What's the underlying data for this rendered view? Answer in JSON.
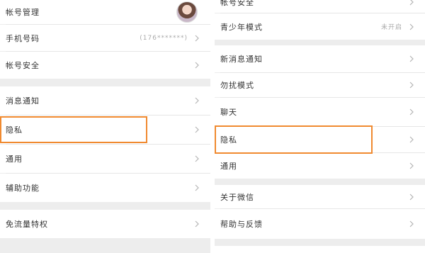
{
  "colors": {
    "highlight": "#f08a30",
    "background": "#ededed",
    "row": "#ffffff"
  },
  "left": {
    "items": [
      {
        "label": "帐号管理",
        "icon": "chevron-right-icon"
      },
      {
        "label": "手机号码",
        "value": "(176*******)"
      },
      {
        "label": "帐号安全"
      },
      {
        "label": "消息通知"
      },
      {
        "label": "隐私"
      },
      {
        "label": "通用"
      },
      {
        "label": "辅助功能"
      },
      {
        "label": "免流量特权"
      }
    ]
  },
  "right": {
    "items": [
      {
        "label": "帐号安全"
      },
      {
        "label": "青少年模式",
        "value": "未开启"
      },
      {
        "label": "新消息通知"
      },
      {
        "label": "勿扰模式"
      },
      {
        "label": "聊天"
      },
      {
        "label": "隐私"
      },
      {
        "label": "通用"
      },
      {
        "label": "关于微信"
      },
      {
        "label": "帮助与反馈"
      }
    ]
  }
}
